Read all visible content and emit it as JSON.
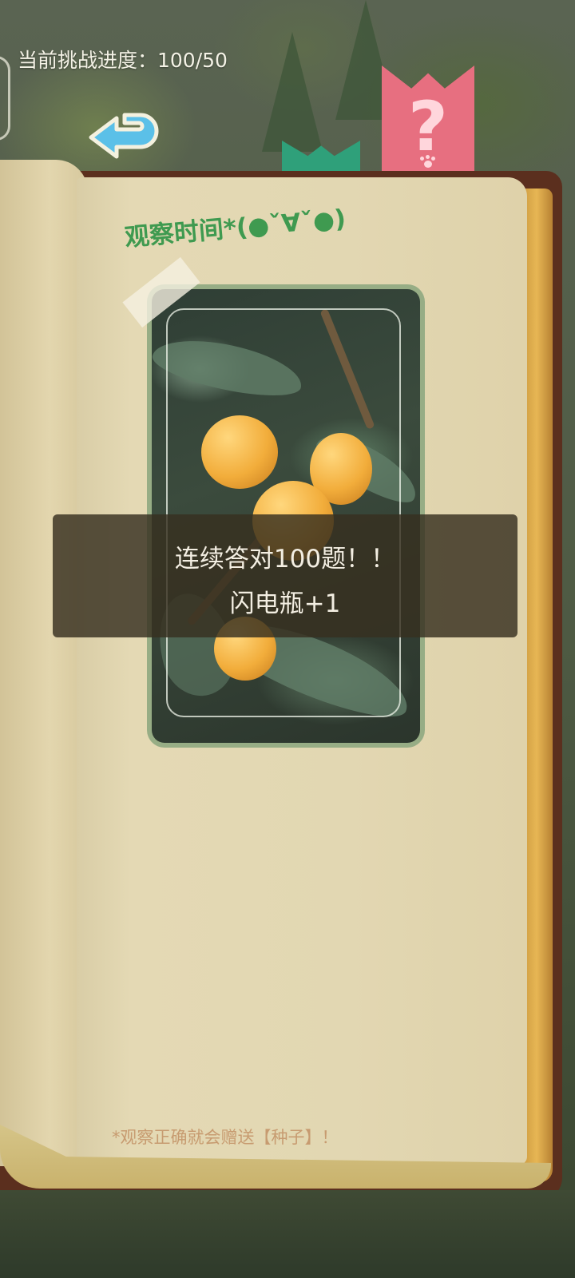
{
  "header": {
    "progress_label": "当前挑战进度：100/50"
  },
  "buttons": {
    "back_icon": "back-arrow-icon",
    "help_icon": "question-mark-icon",
    "help_symbol": "?"
  },
  "page": {
    "title": "观察时间*(●ˇ∀ˇ●)"
  },
  "toast": {
    "line1": "连续答对100题！！",
    "line2": "闪电瓶+1"
  },
  "footer": {
    "note": "*观察正确就会赠送【种子】！"
  },
  "colors": {
    "title_green": "#3f9a50",
    "bookmark_green": "#2fa07a",
    "bookmark_pink": "#e76f80",
    "back_arrow": "#5bc0e8",
    "note_brown": "#c79b70"
  }
}
